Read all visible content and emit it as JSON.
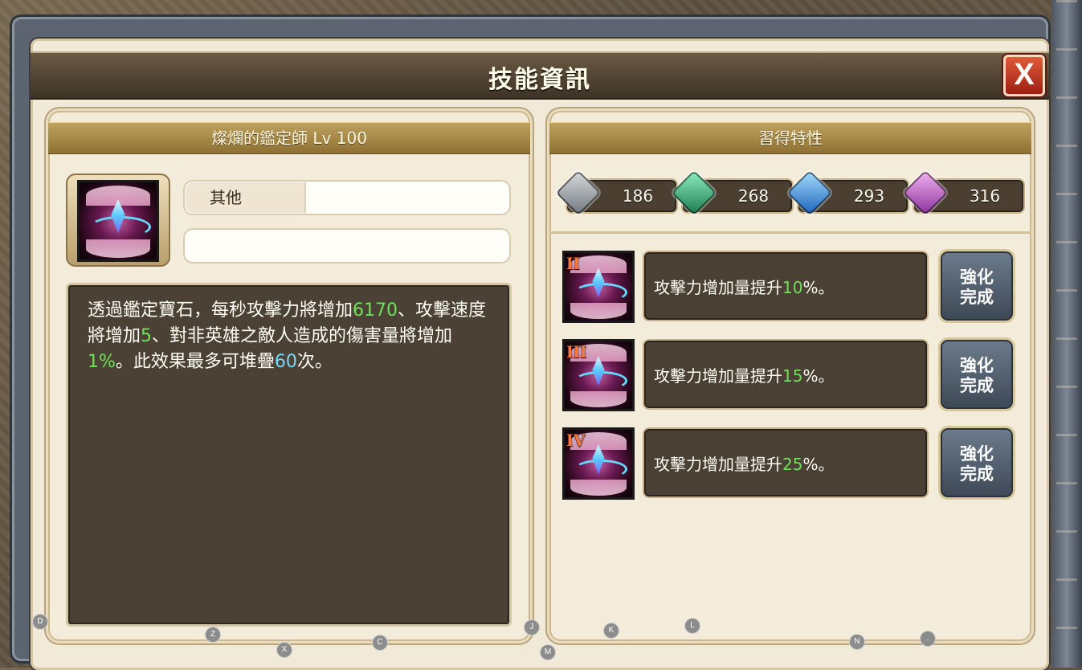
{
  "window": {
    "title": "技能資訊",
    "close_label": "X"
  },
  "skill": {
    "header": "燦爛的鑑定師 Lv 100",
    "type_label": "其他",
    "type_value": "",
    "second_value": "",
    "description_parts": [
      "透過鑑定寶石，每秒攻擊力將增加",
      "6170",
      "、攻擊速度將增加",
      "5",
      "、對非英雄之敵人造成的傷害量將增加",
      "1%",
      "。此效果最多可堆疊",
      "60",
      "次。"
    ]
  },
  "traits": {
    "header": "習得特性",
    "gems": [
      {
        "icon": "gray-gem-icon",
        "count": "186",
        "color": "#9aa0a6"
      },
      {
        "icon": "green-gem-icon",
        "count": "268",
        "color": "#2fae74"
      },
      {
        "icon": "blue-gem-icon",
        "count": "293",
        "color": "#2b8de8"
      },
      {
        "icon": "purple-gem-icon",
        "count": "316",
        "color": "#c25ac9"
      }
    ],
    "rows": [
      {
        "roman": "II",
        "text_prefix": "攻擊力增加量提升",
        "value": "10",
        "text_suffix": "%。",
        "button": "強化\n完成"
      },
      {
        "roman": "III",
        "text_prefix": "攻擊力增加量提升",
        "value": "15",
        "text_suffix": "%。",
        "button": "強化\n完成"
      },
      {
        "roman": "IV",
        "text_prefix": "攻擊力增加量提升",
        "value": "25",
        "text_suffix": "%。",
        "button": "強化\n完成"
      }
    ]
  },
  "hotkeys": [
    "D",
    "Z",
    "X",
    "C",
    "J",
    "M",
    "K",
    "L",
    "N",
    "."
  ],
  "colors": {
    "highlight_green": "#6ee05c",
    "highlight_blue": "#78d8ff",
    "title_bar": "#4a3d2f"
  }
}
